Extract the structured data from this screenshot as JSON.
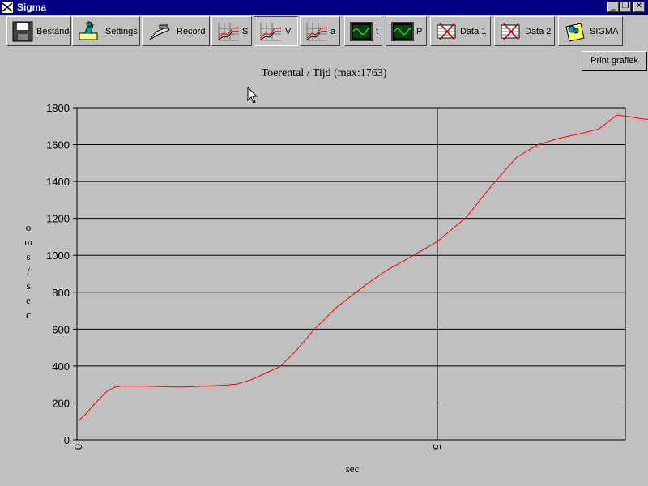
{
  "window": {
    "title": "Sigma",
    "minimize_glyph": "_",
    "restore_glyph": "❐",
    "close_glyph": "✕"
  },
  "toolbar": {
    "buttons": [
      {
        "label": "Bestand",
        "icon": "floppy-disk-icon"
      },
      {
        "label": "Settings",
        "icon": "settings-icon"
      },
      {
        "label": "Record",
        "icon": "record-icon"
      },
      {
        "label": "S",
        "icon": "graph-s-icon"
      },
      {
        "label": "V",
        "icon": "graph-v-icon",
        "pressed": true
      },
      {
        "label": "a",
        "icon": "graph-a-icon"
      },
      {
        "label": "t",
        "icon": "oscilloscope-t-icon"
      },
      {
        "label": "P",
        "icon": "oscilloscope-p-icon"
      },
      {
        "label": "Data 1",
        "icon": "data1-icon"
      },
      {
        "label": "Data 2",
        "icon": "data2-icon"
      },
      {
        "label": "SIGMA",
        "icon": "sigma-icon"
      }
    ]
  },
  "print_button": "Print grafiek",
  "chart_data": {
    "type": "line",
    "title": "Toerental / Tijd (max:1763)",
    "ylabel": "o m s / s e c",
    "xlabel": "sec",
    "ylim": [
      0,
      1800
    ],
    "xlim": [
      0,
      7.8
    ],
    "yticks": [
      "0",
      "200",
      "400",
      "600",
      "800",
      "1000",
      "1200",
      "1400",
      "1600",
      "1800"
    ],
    "xticks": [
      "0",
      "5"
    ],
    "grid": "horizontal lines every 200, vertical line at x=5",
    "line_color": "#ff0000",
    "series": [
      {
        "points": [
          [
            0.0,
            105
          ],
          [
            0.1,
            140
          ],
          [
            0.2,
            185
          ],
          [
            0.3,
            225
          ],
          [
            0.4,
            265
          ],
          [
            0.5,
            285
          ],
          [
            0.6,
            292
          ],
          [
            0.8,
            292
          ],
          [
            1.0,
            290
          ],
          [
            1.2,
            288
          ],
          [
            1.4,
            286
          ],
          [
            1.6,
            288
          ],
          [
            1.8,
            292
          ],
          [
            2.0,
            296
          ],
          [
            2.2,
            302
          ],
          [
            2.4,
            325
          ],
          [
            2.6,
            360
          ],
          [
            2.8,
            395
          ],
          [
            3.0,
            470
          ],
          [
            3.3,
            605
          ],
          [
            3.6,
            720
          ],
          [
            4.0,
            840
          ],
          [
            4.3,
            920
          ],
          [
            4.6,
            985
          ],
          [
            5.0,
            1075
          ],
          [
            5.4,
            1205
          ],
          [
            5.75,
            1375
          ],
          [
            6.1,
            1530
          ],
          [
            6.4,
            1600
          ],
          [
            6.7,
            1635
          ],
          [
            7.0,
            1660
          ],
          [
            7.25,
            1685
          ],
          [
            7.5,
            1760
          ],
          [
            7.7,
            1750
          ],
          [
            7.85,
            1740
          ],
          [
            8.0,
            1735
          ],
          [
            8.1,
            1740
          ]
        ]
      }
    ],
    "x_scale_note": "Original x axis labels only 0 and 5 in seconds; curve spans to ~8.1."
  }
}
